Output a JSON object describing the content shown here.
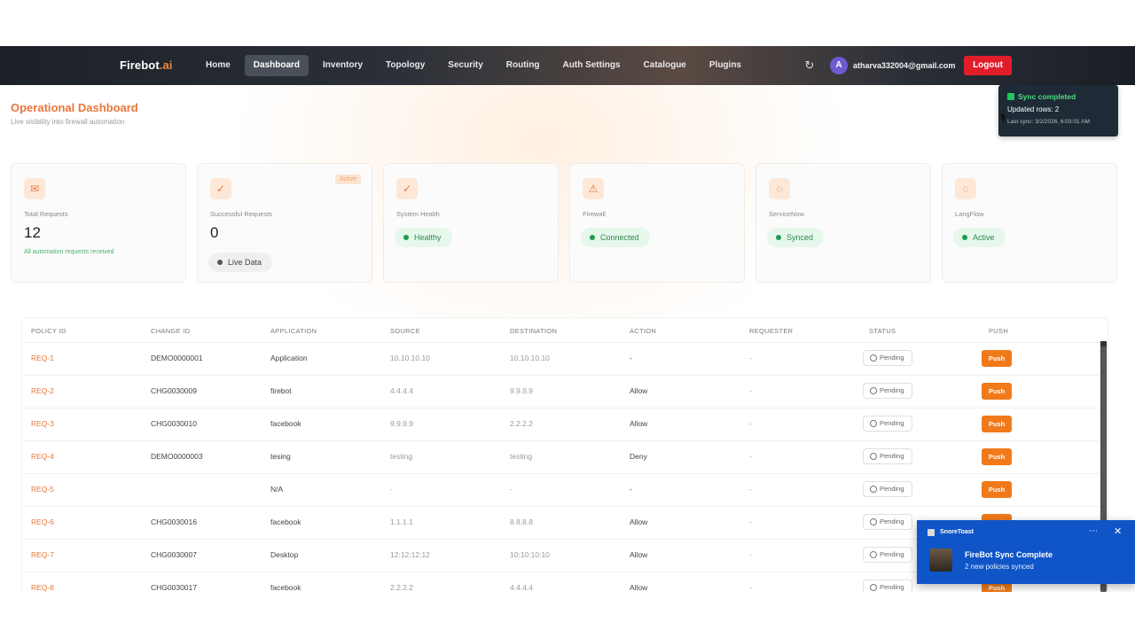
{
  "nav": {
    "brand_main": "Firebot",
    "brand_suffix": ".ai",
    "links": [
      "Home",
      "Dashboard",
      "Inventory",
      "Topology",
      "Security",
      "Routing",
      "Auth Settings",
      "Catalogue",
      "Plugins"
    ],
    "active_link": "Dashboard",
    "refresh_icon": "refresh-icon",
    "avatar_letter": "A",
    "user_email": "atharva332004@gmail.com",
    "logout_label": "Logout"
  },
  "header": {
    "title": "Operational Dashboard",
    "subtitle": "Live visibility into firewall automation"
  },
  "sync_popup": {
    "title": "Sync completed",
    "rows": "Updated rows: 2",
    "last_sync": "Last sync: 3/2/2026, 6:03:01 AM"
  },
  "cards": {
    "total": {
      "icon": "inbox-icon",
      "label": "Total Requests",
      "value": "12",
      "note": "All automation requests received"
    },
    "successful": {
      "icon": "check-circle-icon",
      "label": "Successful Requests",
      "value": "0",
      "badge": "Active",
      "pill": "Live Data"
    },
    "health": {
      "icon": "check-circle-icon",
      "label": "System Health",
      "pill": "Healthy"
    },
    "firewall": {
      "icon": "warning-icon",
      "label": "Firewall",
      "pill": "Connected"
    },
    "servicenow": {
      "icon": "loading-icon",
      "label": "ServiceNow",
      "pill": "Synced"
    },
    "langflow": {
      "icon": "loading-icon",
      "label": "LangFlow",
      "pill": "Active"
    }
  },
  "table": {
    "headers": [
      "POLICY ID",
      "CHANGE ID",
      "APPLICATION",
      "SOURCE",
      "DESTINATION",
      "ACTION",
      "REQUESTER",
      "STATUS",
      "PUSH"
    ],
    "push_label": "Push",
    "rows": [
      {
        "policy": "REQ-1",
        "change": "DEMO0000001",
        "app": "Application",
        "source": "10.10.10.10",
        "dest": "10.10.10.10",
        "action": "-",
        "requester": "-",
        "status": "Pending"
      },
      {
        "policy": "REQ-2",
        "change": "CHG0030009",
        "app": "firebot",
        "source": "4.4.4.4",
        "dest": "9.9.9.9",
        "action": "Allow",
        "requester": "-",
        "status": "Pending"
      },
      {
        "policy": "REQ-3",
        "change": "CHG0030010",
        "app": "facebook",
        "source": "9.9.9.9",
        "dest": "2.2.2.2",
        "action": "Allow",
        "requester": "-",
        "status": "Pending"
      },
      {
        "policy": "REQ-4",
        "change": "DEMO0000003",
        "app": "tesing",
        "source": "testing",
        "dest": "testing",
        "action": "Deny",
        "requester": "-",
        "status": "Pending"
      },
      {
        "policy": "REQ-5",
        "change": "",
        "app": "N/A",
        "source": "-",
        "dest": "-",
        "action": "-",
        "requester": "-",
        "status": "Pending"
      },
      {
        "policy": "REQ-6",
        "change": "CHG0030016",
        "app": "facebook",
        "source": "1.1.1.1",
        "dest": "8.8.8.8",
        "action": "Allow",
        "requester": "-",
        "status": "Pending"
      },
      {
        "policy": "REQ-7",
        "change": "CHG0030007",
        "app": "Desktop",
        "source": "12:12:12:12",
        "dest": "10:10:10:10",
        "action": "Allow",
        "requester": "-",
        "status": "Pending"
      },
      {
        "policy": "REQ-8",
        "change": "CHG0030017",
        "app": "facebook",
        "source": "2.2.2.2",
        "dest": "4.4.4.4",
        "action": "Allow",
        "requester": "-",
        "status": "Pending"
      }
    ]
  },
  "toast": {
    "app_name": "SnoreToast",
    "more_icon": "more-icon",
    "close_icon": "close-icon",
    "title": "FireBot Sync Complete",
    "body": "2 new policies synced"
  },
  "colors": {
    "accent": "#e8763b",
    "logout": "#e11d2a",
    "push": "#f07a1a",
    "toast": "#0f55c8"
  }
}
